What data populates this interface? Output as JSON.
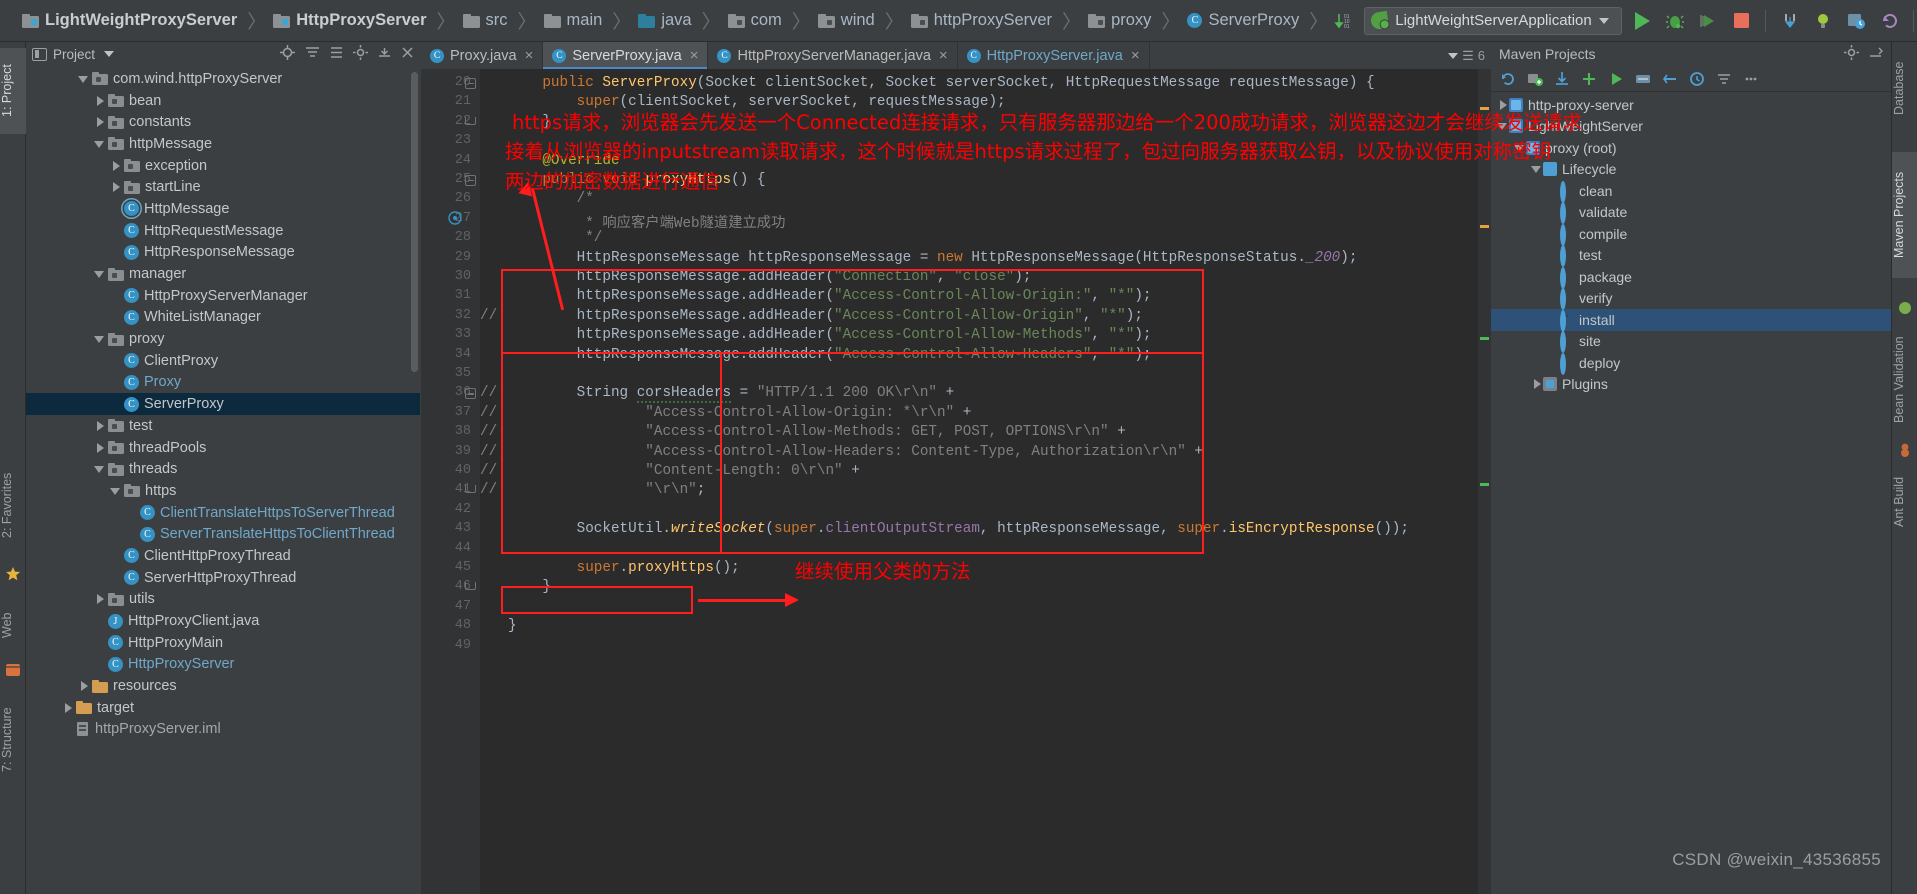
{
  "window": {
    "watermark": "CSDN @weixin_43536855"
  },
  "breadcrumb": [
    {
      "label": "LightWeightProxyServer",
      "icon": "module-folder-icon",
      "bold": true
    },
    {
      "label": "HttpProxyServer",
      "icon": "module-folder-icon",
      "bold": true
    },
    {
      "label": "src",
      "icon": "folder-icon",
      "bold": false
    },
    {
      "label": "main",
      "icon": "folder-icon",
      "bold": false
    },
    {
      "label": "java",
      "icon": "source-root-folder-icon",
      "bold": false
    },
    {
      "label": "com",
      "icon": "package-folder-icon",
      "bold": false
    },
    {
      "label": "wind",
      "icon": "package-folder-icon",
      "bold": false
    },
    {
      "label": "httpProxyServer",
      "icon": "package-folder-icon",
      "bold": false
    },
    {
      "label": "proxy",
      "icon": "package-folder-icon",
      "bold": false
    },
    {
      "label": "ServerProxy",
      "icon": "java-class-icon",
      "bold": false
    }
  ],
  "toolbar": {
    "run_config": "LightWeightServerApplication",
    "icons": [
      "sort-numeric-icon",
      "run-icon",
      "debug-icon",
      "run-coverage-icon",
      "stop-icon",
      "step-into-icon",
      "hint-bulb-icon",
      "screenshot-icon",
      "revert-icon",
      "calculator-icon",
      "search-icon"
    ]
  },
  "left_tool_strip": [
    {
      "label": "1: Project",
      "selected": true
    },
    {
      "label": "2: Favorites",
      "selected": false
    },
    {
      "label": "Web",
      "selected": false
    },
    {
      "label": "7: Structure",
      "selected": false
    }
  ],
  "right_tool_strip": [
    {
      "label": "Database",
      "selected": false
    },
    {
      "label": "Maven Projects",
      "selected": true
    },
    {
      "label": "Bean Validation",
      "selected": false
    },
    {
      "label": "Ant Build",
      "selected": false
    }
  ],
  "project_panel": {
    "title": "Project",
    "icons": [
      "locate-icon",
      "collapse-all-icon",
      "expand-icon",
      "settings-icon",
      "hide-icon",
      "close-icon"
    ],
    "tree": [
      {
        "label": "com.wind.httpProxyServer",
        "indent": 3,
        "arrow": "open",
        "icon": "package-folder-icon",
        "style": "normal"
      },
      {
        "label": "bean",
        "indent": 4,
        "arrow": "closed",
        "icon": "package-folder-icon",
        "style": "normal"
      },
      {
        "label": "constants",
        "indent": 4,
        "arrow": "closed",
        "icon": "package-folder-icon",
        "style": "normal"
      },
      {
        "label": "httpMessage",
        "indent": 4,
        "arrow": "open",
        "icon": "package-folder-icon",
        "style": "normal"
      },
      {
        "label": "exception",
        "indent": 5,
        "arrow": "closed",
        "icon": "package-folder-icon",
        "style": "normal"
      },
      {
        "label": "startLine",
        "indent": 5,
        "arrow": "closed",
        "icon": "package-folder-icon",
        "style": "normal"
      },
      {
        "label": "HttpMessage",
        "indent": 5,
        "arrow": "none",
        "icon": "java-interface-icon",
        "style": "normal"
      },
      {
        "label": "HttpRequestMessage",
        "indent": 5,
        "arrow": "none",
        "icon": "java-class-icon",
        "style": "normal"
      },
      {
        "label": "HttpResponseMessage",
        "indent": 5,
        "arrow": "none",
        "icon": "java-class-icon",
        "style": "normal"
      },
      {
        "label": "manager",
        "indent": 4,
        "arrow": "open",
        "icon": "package-folder-icon",
        "style": "normal"
      },
      {
        "label": "HttpProxyServerManager",
        "indent": 5,
        "arrow": "none",
        "icon": "java-class-icon",
        "style": "normal"
      },
      {
        "label": "WhiteListManager",
        "indent": 5,
        "arrow": "none",
        "icon": "java-class-icon",
        "style": "normal"
      },
      {
        "label": "proxy",
        "indent": 4,
        "arrow": "open",
        "icon": "package-folder-icon",
        "style": "normal"
      },
      {
        "label": "ClientProxy",
        "indent": 5,
        "arrow": "none",
        "icon": "java-class-icon",
        "style": "normal"
      },
      {
        "label": "Proxy",
        "indent": 5,
        "arrow": "none",
        "icon": "java-class-icon",
        "style": "lightblue"
      },
      {
        "label": "ServerProxy",
        "indent": 5,
        "arrow": "none",
        "icon": "java-class-icon",
        "style": "selected"
      },
      {
        "label": "test",
        "indent": 4,
        "arrow": "closed",
        "icon": "package-folder-icon",
        "style": "normal"
      },
      {
        "label": "threadPools",
        "indent": 4,
        "arrow": "closed",
        "icon": "package-folder-icon",
        "style": "normal"
      },
      {
        "label": "threads",
        "indent": 4,
        "arrow": "open",
        "icon": "package-folder-icon",
        "style": "normal"
      },
      {
        "label": "https",
        "indent": 5,
        "arrow": "open",
        "icon": "package-folder-icon",
        "style": "normal"
      },
      {
        "label": "ClientTranslateHttpsToServerThread",
        "indent": 6,
        "arrow": "none",
        "icon": "java-class-icon",
        "style": "lightblue"
      },
      {
        "label": "ServerTranslateHttpsToClientThread",
        "indent": 6,
        "arrow": "none",
        "icon": "java-class-icon",
        "style": "lightblue"
      },
      {
        "label": "ClientHttpProxyThread",
        "indent": 5,
        "arrow": "none",
        "icon": "java-class-icon",
        "style": "normal"
      },
      {
        "label": "ServerHttpProxyThread",
        "indent": 5,
        "arrow": "none",
        "icon": "java-class-icon",
        "style": "normal"
      },
      {
        "label": "utils",
        "indent": 4,
        "arrow": "closed",
        "icon": "package-folder-icon",
        "style": "normal"
      },
      {
        "label": "HttpProxyClient.java",
        "indent": 4,
        "arrow": "none",
        "icon": "java-file-icon",
        "style": "normal"
      },
      {
        "label": "HttpProxyMain",
        "indent": 4,
        "arrow": "none",
        "icon": "java-class-icon",
        "style": "normal"
      },
      {
        "label": "HttpProxyServer",
        "indent": 4,
        "arrow": "none",
        "icon": "java-class-icon",
        "style": "lightblue"
      },
      {
        "label": "resources",
        "indent": 3,
        "arrow": "closed",
        "icon": "resources-folder-icon",
        "style": "normal"
      },
      {
        "label": "target",
        "indent": 2,
        "arrow": "closed",
        "icon": "target-folder-icon",
        "style": "normal"
      },
      {
        "label": "httpProxyServer.iml",
        "indent": 2,
        "arrow": "none",
        "icon": "iml-file-icon",
        "style": "iml"
      }
    ]
  },
  "editor": {
    "tabs": [
      {
        "label": "Proxy.java",
        "active": false,
        "style": "normal"
      },
      {
        "label": "ServerProxy.java",
        "active": true,
        "style": "normal"
      },
      {
        "label": "HttpProxyServerManager.java",
        "active": false,
        "style": "normal"
      },
      {
        "label": "HttpProxyServer.java",
        "active": false,
        "style": "blue"
      }
    ],
    "tab_right_label": "6",
    "first_line_number": 20,
    "last_line_number": 49,
    "lines": [
      {
        "n": 20,
        "fold": "top",
        "html": "    <span class='kw'>public</span> <span class='mth'>ServerProxy</span>(Socket clientSocket, Socket serverSocket, HttpRequestMessage requestMessage) {"
      },
      {
        "n": 21,
        "fold": "",
        "html": "        <span class='kw'>super</span>(clientSocket, serverSocket, requestMessage);"
      },
      {
        "n": 22,
        "fold": "bot",
        "html": "    }"
      },
      {
        "n": 23,
        "fold": "",
        "html": ""
      },
      {
        "n": 24,
        "fold": "",
        "html": "    <span class='ann'>@Override</span>"
      },
      {
        "n": 25,
        "fold": "top",
        "html": "    <span class='kw'>public</span> <span class='kw'>void</span> <span class='mth'>proxyHttps</span>() {"
      },
      {
        "n": 26,
        "fold": "",
        "html": "        <span class='cmt'>/*</span>"
      },
      {
        "n": 27,
        "fold": "",
        "html": "        <span class='cmt'> * 响应客户端Web隧道建立成功</span>"
      },
      {
        "n": 28,
        "fold": "",
        "html": "        <span class='cmt'> */</span>"
      },
      {
        "n": 29,
        "fold": "",
        "html": "        HttpResponseMessage httpResponseMessage = <span class='kw'>new</span> HttpResponseMessage(HttpResponseStatus.<span class='num'>_200</span>);"
      },
      {
        "n": 30,
        "fold": "",
        "html": "        httpResponseMessage.addHeader(<span class='str'>\"Connection\"</span>, <span class='str'>\"close\"</span>);"
      },
      {
        "n": 31,
        "fold": "",
        "html": "        httpResponseMessage.addHeader(<span class='str'>\"Access-Control-Allow-Origin:\"</span>, <span class='str'>\"*\"</span>);"
      },
      {
        "n": 32,
        "fold": "",
        "comment_prefix": "//",
        "html": "        httpResponseMessage.addHeader(<span class='str'>\"Access-Control-Allow-Origin\"</span>, <span class='str'>\"*\"</span>);"
      },
      {
        "n": 33,
        "fold": "",
        "html": "        httpResponseMessage.addHeader(<span class='str'>\"Access-Control-Allow-Methods\"</span>, <span class='str'>\"*\"</span>);"
      },
      {
        "n": 34,
        "fold": "",
        "html": "        httpResponseMessage.addHeader(<span class='str'>\"Access-Control-Allow-Headers\"</span>, <span class='str'>\"*\"</span>);"
      },
      {
        "n": 35,
        "fold": "",
        "html": ""
      },
      {
        "n": 36,
        "fold": "top",
        "comment_prefix": "//",
        "html": "        String <span class='wavy'>corsHeaders</span> = <span class='cmtl'>\"HTTP/1.1 200 OK\\r\\n\"</span> +"
      },
      {
        "n": 37,
        "fold": "",
        "comment_prefix": "//",
        "html": "                <span class='cmtl'>\"Access-Control-Allow-Origin: *\\r\\n\"</span> +"
      },
      {
        "n": 38,
        "fold": "",
        "comment_prefix": "//",
        "html": "                <span class='cmtl'>\"Access-Control-Allow-Methods: GET, POST, OPTIONS\\r\\n\"</span> +"
      },
      {
        "n": 39,
        "fold": "",
        "comment_prefix": "//",
        "html": "                <span class='cmtl'>\"Access-Control-Allow-Headers: Content-Type, Authorization\\r\\n\"</span> +"
      },
      {
        "n": 40,
        "fold": "",
        "comment_prefix": "//",
        "html": "                <span class='cmtl'>\"Content-Length: 0\\r\\n\"</span> +"
      },
      {
        "n": 41,
        "fold": "bot",
        "comment_prefix": "//",
        "html": "                <span class='cmtl'>\"\\r\\n\"</span>;"
      },
      {
        "n": 42,
        "fold": "",
        "html": ""
      },
      {
        "n": 43,
        "fold": "",
        "html": "        SocketUtil.<span class='mth ital'>writeSocket</span>(<span class='kw'>super</span>.<span class='fld'>clientOutputStream</span>, httpResponseMessage, <span class='kw'>super</span>.<span class='mth'>isEncryptResponse</span>());"
      },
      {
        "n": 44,
        "fold": "",
        "html": ""
      },
      {
        "n": 45,
        "fold": "",
        "html": "        <span class='kw'>super</span>.<span class='mth'>proxyHttps</span>();"
      },
      {
        "n": 46,
        "fold": "bot",
        "html": "    }"
      },
      {
        "n": 47,
        "fold": "",
        "html": ""
      },
      {
        "n": 48,
        "fold": "",
        "html": "}"
      },
      {
        "n": 49,
        "fold": "",
        "html": ""
      }
    ]
  },
  "annotations": {
    "line1": "https请求，浏览器会先发送一个Connected连接请求，只有服务器那边给一个200成功请求，浏览器这边才会继续发送请求",
    "line2": "接着从浏览器的inputstream读取请求，这个时候就是https请求过程了，包过向服务器获取公钥，以及协议使用对称密钥",
    "line3": "两边的加密数据进行通信",
    "line4": "继续使用父类的方法"
  },
  "maven_panel": {
    "title": "Maven Projects",
    "toolbar_icons": [
      "refresh-icon",
      "add-maven-project-icon",
      "download-sources-icon",
      "plus-icon",
      "run-maven-build-icon",
      "toggle-offline-icon",
      "skip-tests-icon",
      "execute-goal-icon",
      "collapse-icon",
      "more-icon"
    ],
    "tree": [
      {
        "label": "http-proxy-server",
        "indent": 0,
        "arrow": "closed",
        "icon": "maven-module-icon",
        "selected": false
      },
      {
        "label": "LightWeightServer",
        "indent": 0,
        "arrow": "open",
        "icon": "maven-module-icon",
        "selected": false
      },
      {
        "label": "proxy (root)",
        "indent": 1,
        "arrow": "open",
        "icon": "maven-module-icon",
        "selected": false
      },
      {
        "label": "Lifecycle",
        "indent": 2,
        "arrow": "open",
        "icon": "lifecycle-icon",
        "selected": false
      },
      {
        "label": "clean",
        "indent": 3,
        "arrow": "none",
        "icon": "maven-goal-icon",
        "selected": false
      },
      {
        "label": "validate",
        "indent": 3,
        "arrow": "none",
        "icon": "maven-goal-icon",
        "selected": false
      },
      {
        "label": "compile",
        "indent": 3,
        "arrow": "none",
        "icon": "maven-goal-icon",
        "selected": false
      },
      {
        "label": "test",
        "indent": 3,
        "arrow": "none",
        "icon": "maven-goal-icon",
        "selected": false
      },
      {
        "label": "package",
        "indent": 3,
        "arrow": "none",
        "icon": "maven-goal-icon",
        "selected": false
      },
      {
        "label": "verify",
        "indent": 3,
        "arrow": "none",
        "icon": "maven-goal-icon",
        "selected": false
      },
      {
        "label": "install",
        "indent": 3,
        "arrow": "none",
        "icon": "maven-goal-icon",
        "selected": true
      },
      {
        "label": "site",
        "indent": 3,
        "arrow": "none",
        "icon": "maven-goal-icon",
        "selected": false
      },
      {
        "label": "deploy",
        "indent": 3,
        "arrow": "none",
        "icon": "maven-goal-icon",
        "selected": false
      },
      {
        "label": "Plugins",
        "indent": 2,
        "arrow": "closed",
        "icon": "plugins-icon",
        "selected": false
      }
    ]
  },
  "colors": {
    "accent_blue": "#3592c4",
    "annotation_red": "#ff0000",
    "selection_navy": "#0d293e",
    "maven_selection": "#2d5177",
    "editor_bg": "#2b2b2b",
    "panel_bg": "#3c3f41"
  }
}
